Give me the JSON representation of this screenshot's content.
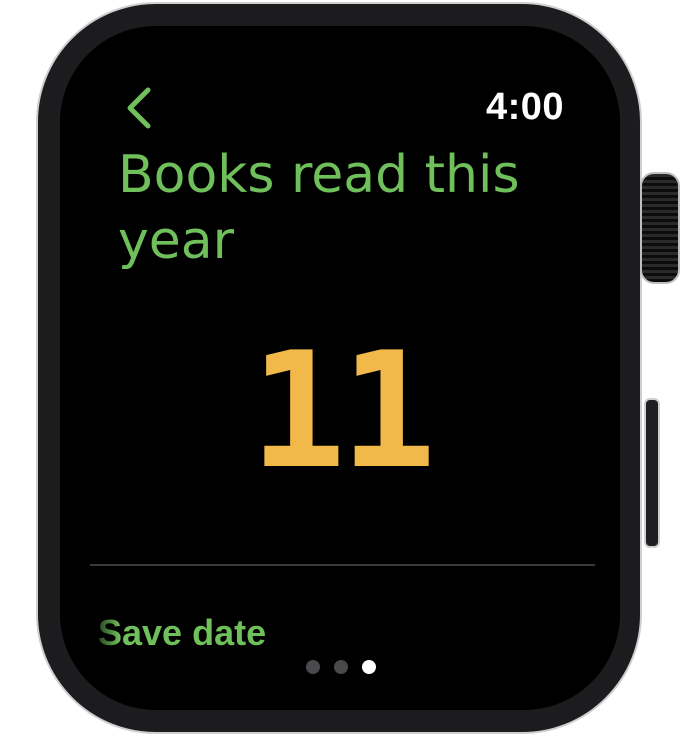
{
  "status": {
    "time": "4:00"
  },
  "navigation": {
    "back_icon": "chevron-left-icon"
  },
  "content": {
    "title": "Books read this year",
    "count": "11",
    "action_label": "Save date"
  },
  "pagination": {
    "total_pages": 3,
    "current_page": 3
  },
  "colors": {
    "accent_green": "#6fc05b",
    "count_yellow": "#f1b84a",
    "background": "#000000",
    "clock_text": "#ffffff"
  }
}
